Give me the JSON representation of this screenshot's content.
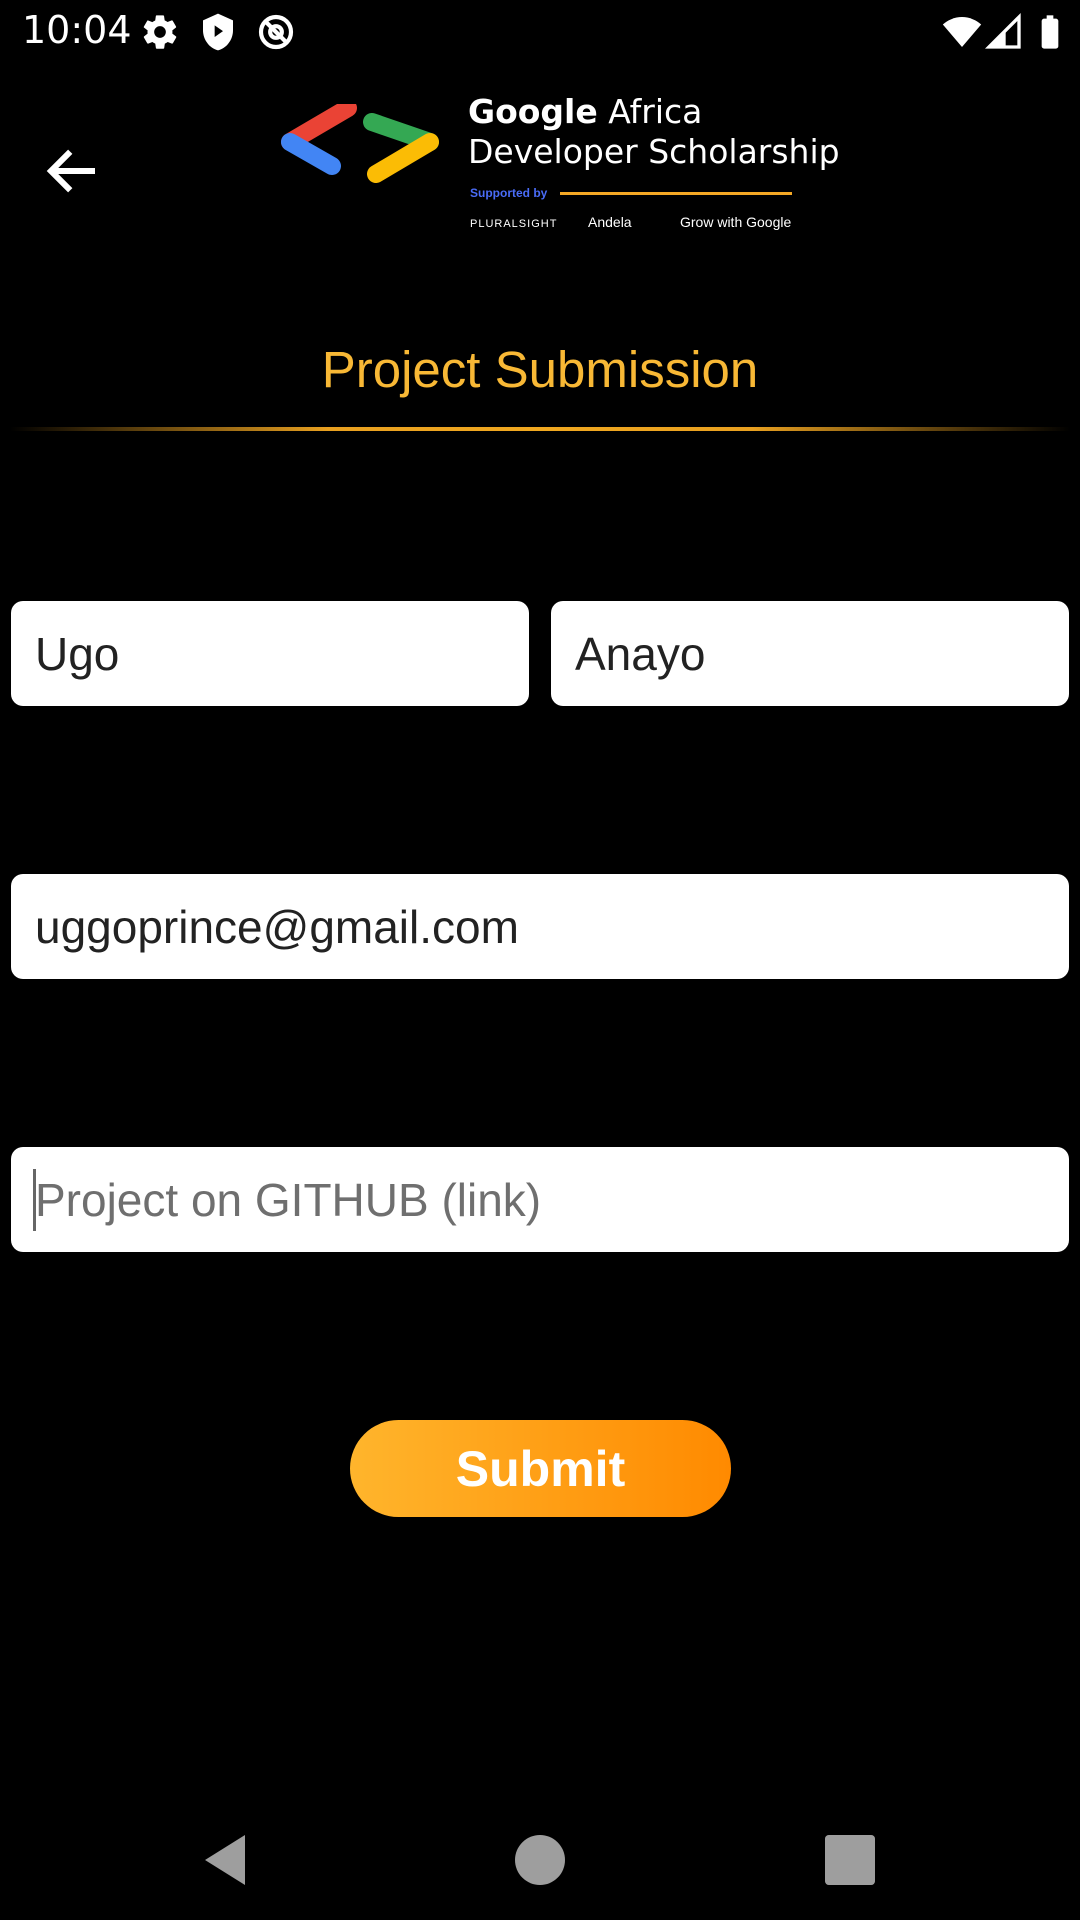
{
  "status_bar": {
    "time": "10:04",
    "icons": [
      "gear-icon",
      "shield-icon",
      "at-icon",
      "wifi-icon",
      "signal-icon",
      "battery-icon"
    ]
  },
  "header": {
    "back_icon": "arrow-left-icon",
    "logo": {
      "title_bold": "Google",
      "title_rest": " Africa",
      "subtitle": "Developer Scholarship",
      "supported_by": "Supported by",
      "sponsors": [
        "PLURALSIGHT",
        "Andela",
        "Grow with Google"
      ]
    }
  },
  "page_title": "Project Submission",
  "form": {
    "first_name": {
      "value": "Ugo",
      "placeholder": ""
    },
    "last_name": {
      "value": "Anayo",
      "placeholder": ""
    },
    "email": {
      "value": "uggoprince@gmail.com",
      "placeholder": ""
    },
    "github": {
      "value": "",
      "placeholder": "Project on GITHUB (link)"
    },
    "submit_label": "Submit"
  },
  "nav_bar": {
    "icons": [
      "back-triangle-icon",
      "home-circle-icon",
      "recents-square-icon"
    ]
  },
  "colors": {
    "title": "#f8b835",
    "submit_start": "#ffb52c",
    "submit_end": "#ff8a00",
    "background": "#000000"
  }
}
